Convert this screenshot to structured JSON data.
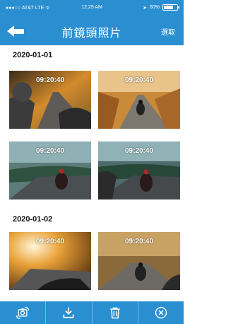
{
  "status_bar": {
    "carrier": "●●●○○ AT&T  LTE ᯤ",
    "time": "12:25 AM",
    "location_icon": "location-arrow-icon",
    "battery_text": "60%",
    "battery_level": 0.6
  },
  "nav": {
    "back_icon": "back-arrow-icon",
    "title": "前鏡頭照片",
    "select_label": "選取"
  },
  "sections": [
    {
      "date": "2020-01-01",
      "photos": [
        {
          "timestamp": "09:20:40",
          "scene": "autumn-pov"
        },
        {
          "timestamp": "09:20:40",
          "scene": "autumn-road-rider"
        },
        {
          "timestamp": "09:20:40",
          "scene": "evening-road-rider"
        },
        {
          "timestamp": "09:20:40",
          "scene": "evening-road-rider-close"
        }
      ]
    },
    {
      "date": "2020-01-02",
      "photos": [
        {
          "timestamp": "09:20:40",
          "scene": "autumn-sun-pov"
        },
        {
          "timestamp": "09:20:40",
          "scene": "dusk-road-rider"
        }
      ]
    }
  ],
  "toolbar": {
    "items": [
      {
        "icon": "switch-camera-icon"
      },
      {
        "icon": "download-icon"
      },
      {
        "icon": "trash-icon"
      },
      {
        "icon": "close-circle-icon"
      }
    ]
  },
  "colors": {
    "primary": "#2a8fd0",
    "background": "#ffffff"
  }
}
